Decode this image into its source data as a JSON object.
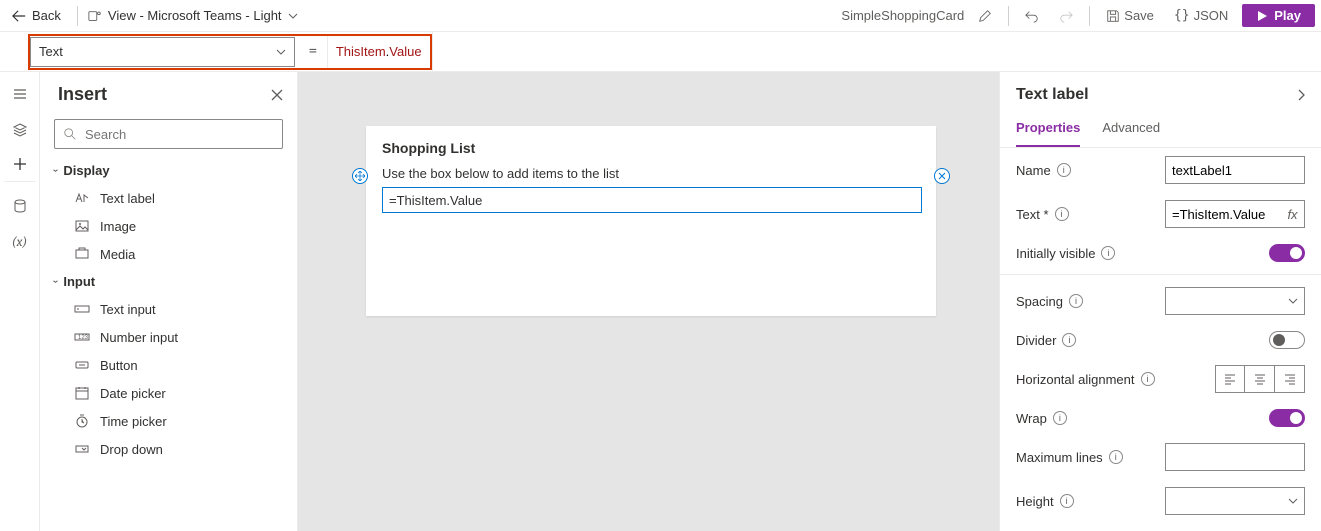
{
  "cmdbar": {
    "back": "Back",
    "view_label": "View - Microsoft Teams - Light",
    "app_name": "SimpleShoppingCard",
    "save": "Save",
    "json": "JSON",
    "play": "Play"
  },
  "formula": {
    "property": "Text",
    "token_this": "ThisItem",
    "token_dot": ".",
    "token_value": "Value"
  },
  "insert": {
    "title": "Insert",
    "search_placeholder": "Search",
    "cat_display": "Display",
    "cat_input": "Input",
    "items_display": [
      "Text label",
      "Image",
      "Media"
    ],
    "items_input": [
      "Text input",
      "Number input",
      "Button",
      "Date picker",
      "Time picker",
      "Drop down"
    ]
  },
  "canvas": {
    "card_title": "Shopping List",
    "card_sub": "Use the box below to add items to the list",
    "selected_text": "=ThisItem.Value"
  },
  "props": {
    "title": "Text label",
    "tab_props": "Properties",
    "tab_adv": "Advanced",
    "name_label": "Name",
    "name_value": "textLabel1",
    "text_label": "Text *",
    "text_value": "=ThisItem.Value",
    "visible_label": "Initially visible",
    "spacing_label": "Spacing",
    "divider_label": "Divider",
    "halign_label": "Horizontal alignment",
    "wrap_label": "Wrap",
    "maxlines_label": "Maximum lines",
    "height_label": "Height"
  }
}
